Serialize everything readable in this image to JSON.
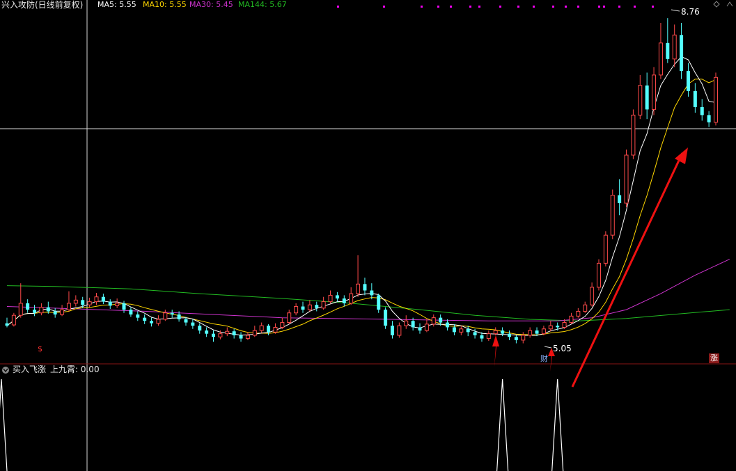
{
  "header": {
    "title": "兴入攻防",
    "subtitle": "(日线前复权)",
    "ma": [
      {
        "label": "MA5: 5.55",
        "color": "#ffffff"
      },
      {
        "label": "MA10: 5.55",
        "color": "#ffd700"
      },
      {
        "label": "MA30: 5.45",
        "color": "#cc33cc"
      },
      {
        "label": "MA144: 5.67",
        "color": "#22bb22"
      }
    ]
  },
  "indicator": {
    "title": "买入飞涨",
    "subtitle": "上九霄: 0.00",
    "toggle_icon": "chevron-down-icon"
  },
  "annotations": {
    "high_label": "8.76",
    "low_label": "5.05",
    "cai_marker": "财",
    "zhang_marker": "涨",
    "dollar_marker": "$"
  },
  "colors": {
    "up": "#ff4a4a",
    "down": "#54ffff",
    "ma5": "#ffffff",
    "ma10": "#ffd700",
    "ma30": "#cc33cc",
    "ma144": "#22bb22",
    "signal": "#ffffff",
    "arrow": "#ee1111",
    "dot": "#ee00ee",
    "divider": "#8a1515"
  },
  "chart_data": {
    "type": "candlestick",
    "candles": [
      [
        4.95,
        4.92,
        5.02,
        4.9
      ],
      [
        4.93,
        5.05,
        5.08,
        4.91
      ],
      [
        5.05,
        5.2,
        5.45,
        5.02
      ],
      [
        5.2,
        5.12,
        5.25,
        5.08
      ],
      [
        5.12,
        5.08,
        5.18,
        5.04
      ],
      [
        5.08,
        5.15,
        5.2,
        5.05
      ],
      [
        5.15,
        5.1,
        5.22,
        5.07
      ],
      [
        5.1,
        5.06,
        5.14,
        5.02
      ],
      [
        5.06,
        5.12,
        5.18,
        5.04
      ],
      [
        5.12,
        5.2,
        5.35,
        5.1
      ],
      [
        5.2,
        5.24,
        5.3,
        5.16
      ],
      [
        5.24,
        5.18,
        5.28,
        5.14
      ],
      [
        5.18,
        5.22,
        5.27,
        5.15
      ],
      [
        5.22,
        5.28,
        5.33,
        5.18
      ],
      [
        5.28,
        5.22,
        5.32,
        5.19
      ],
      [
        5.22,
        5.17,
        5.25,
        5.13
      ],
      [
        5.17,
        5.2,
        5.26,
        5.14
      ],
      [
        5.2,
        5.12,
        5.23,
        5.08
      ],
      [
        5.12,
        5.06,
        5.15,
        5.03
      ],
      [
        5.06,
        5.02,
        5.1,
        4.98
      ],
      [
        5.02,
        4.98,
        5.06,
        4.94
      ],
      [
        4.98,
        4.95,
        5.02,
        4.91
      ],
      [
        4.95,
        5.0,
        5.05,
        4.92
      ],
      [
        5.0,
        5.08,
        5.12,
        4.98
      ],
      [
        5.08,
        5.06,
        5.12,
        5.02
      ],
      [
        5.06,
        5.0,
        5.1,
        4.97
      ],
      [
        5.0,
        4.96,
        5.03,
        4.92
      ],
      [
        4.96,
        4.92,
        5.0,
        4.88
      ],
      [
        4.92,
        4.86,
        4.95,
        4.82
      ],
      [
        4.86,
        4.82,
        4.9,
        4.78
      ],
      [
        4.82,
        4.78,
        4.86,
        4.72
      ],
      [
        4.78,
        4.82,
        4.86,
        4.75
      ],
      [
        4.82,
        4.85,
        4.9,
        4.79
      ],
      [
        4.85,
        4.8,
        4.88,
        4.76
      ],
      [
        4.8,
        4.76,
        4.84,
        4.72
      ],
      [
        4.76,
        4.8,
        4.84,
        4.74
      ],
      [
        4.8,
        4.86,
        4.92,
        4.78
      ],
      [
        4.86,
        4.92,
        4.96,
        4.83
      ],
      [
        4.92,
        4.84,
        4.94,
        4.8
      ],
      [
        4.84,
        4.9,
        4.95,
        4.82
      ],
      [
        4.9,
        4.96,
        5.02,
        4.88
      ],
      [
        4.96,
        5.08,
        5.12,
        4.94
      ],
      [
        5.08,
        5.16,
        5.2,
        5.05
      ],
      [
        5.16,
        5.12,
        5.22,
        5.08
      ],
      [
        5.12,
        5.18,
        5.24,
        5.1
      ],
      [
        5.18,
        5.14,
        5.22,
        5.1
      ],
      [
        5.14,
        5.22,
        5.28,
        5.12
      ],
      [
        5.22,
        5.3,
        5.36,
        5.2
      ],
      [
        5.3,
        5.26,
        5.34,
        5.22
      ],
      [
        5.26,
        5.2,
        5.3,
        5.16
      ],
      [
        5.2,
        5.32,
        5.4,
        5.18
      ],
      [
        5.32,
        5.44,
        5.8,
        5.28
      ],
      [
        5.44,
        5.36,
        5.52,
        5.3
      ],
      [
        5.36,
        5.3,
        5.45,
        5.25
      ],
      [
        5.3,
        5.12,
        5.32,
        5.08
      ],
      [
        5.12,
        4.92,
        5.15,
        4.88
      ],
      [
        4.92,
        4.8,
        4.98,
        4.76
      ],
      [
        4.8,
        4.92,
        4.96,
        4.77
      ],
      [
        4.92,
        4.98,
        5.05,
        4.88
      ],
      [
        4.98,
        4.9,
        5.02,
        4.86
      ],
      [
        4.9,
        4.86,
        4.95,
        4.82
      ],
      [
        4.86,
        4.94,
        5.0,
        4.84
      ],
      [
        4.94,
        5.02,
        5.06,
        4.91
      ],
      [
        5.02,
        4.96,
        5.06,
        4.92
      ],
      [
        4.96,
        4.9,
        5.0,
        4.86
      ],
      [
        4.9,
        4.84,
        4.94,
        4.8
      ],
      [
        4.84,
        4.88,
        4.92,
        4.8
      ],
      [
        4.88,
        4.84,
        4.92,
        4.79
      ],
      [
        4.84,
        4.8,
        4.88,
        4.76
      ],
      [
        4.8,
        4.76,
        4.84,
        4.72
      ],
      [
        4.76,
        4.82,
        4.86,
        4.73
      ],
      [
        4.82,
        4.86,
        4.9,
        4.8
      ],
      [
        4.86,
        4.82,
        4.9,
        4.79
      ],
      [
        4.82,
        4.78,
        4.86,
        4.74
      ],
      [
        4.78,
        4.74,
        4.8,
        4.7
      ],
      [
        4.74,
        4.8,
        4.84,
        4.7
      ],
      [
        4.8,
        4.86,
        4.9,
        4.77
      ],
      [
        4.86,
        4.82,
        4.9,
        4.79
      ],
      [
        4.82,
        4.88,
        4.92,
        4.8
      ],
      [
        4.88,
        4.92,
        4.98,
        4.85
      ],
      [
        4.92,
        4.9,
        4.96,
        4.86
      ],
      [
        4.9,
        4.96,
        5.0,
        4.88
      ],
      [
        4.96,
        5.04,
        5.08,
        4.94
      ],
      [
        5.04,
        5.1,
        5.14,
        5.02
      ],
      [
        5.1,
        5.18,
        5.22,
        5.08
      ],
      [
        5.18,
        5.4,
        5.46,
        5.16
      ],
      [
        5.4,
        5.7,
        5.75,
        5.36
      ],
      [
        5.7,
        6.05,
        6.1,
        5.66
      ],
      [
        6.05,
        6.55,
        6.62,
        6.0
      ],
      [
        6.55,
        6.45,
        6.75,
        6.3
      ],
      [
        6.45,
        7.05,
        7.12,
        6.4
      ],
      [
        7.05,
        7.55,
        7.62,
        7.0
      ],
      [
        7.55,
        7.92,
        8.05,
        7.5
      ],
      [
        7.92,
        7.62,
        8.08,
        7.5
      ],
      [
        7.62,
        8.05,
        8.15,
        7.55
      ],
      [
        8.05,
        8.45,
        8.7,
        8.0
      ],
      [
        8.45,
        8.25,
        8.76,
        8.2
      ],
      [
        8.25,
        8.55,
        8.68,
        8.15
      ],
      [
        8.55,
        8.1,
        8.7,
        8.0
      ],
      [
        8.1,
        7.85,
        8.2,
        7.78
      ],
      [
        7.85,
        7.65,
        7.95,
        7.58
      ],
      [
        7.65,
        7.55,
        7.75,
        7.48
      ],
      [
        7.55,
        7.46,
        7.6,
        7.4
      ],
      [
        7.46,
        8.02,
        8.08,
        7.42
      ]
    ],
    "ma144": [
      [
        0,
        5.42
      ],
      [
        7,
        5.41
      ],
      [
        18,
        5.38
      ],
      [
        28,
        5.32
      ],
      [
        40,
        5.26
      ],
      [
        50,
        5.2
      ],
      [
        60,
        5.12
      ],
      [
        68,
        5.05
      ],
      [
        76,
        5.0
      ],
      [
        83,
        4.98
      ],
      [
        90,
        5.01
      ],
      [
        98,
        5.07
      ],
      [
        105,
        5.12
      ]
    ],
    "ma30_line": [
      [
        0,
        5.16
      ],
      [
        20,
        5.1
      ],
      [
        40,
        5.02
      ],
      [
        56,
        5.0
      ],
      [
        70,
        4.98
      ],
      [
        80,
        4.98
      ],
      [
        85,
        5.02
      ],
      [
        90,
        5.12
      ],
      [
        95,
        5.32
      ],
      [
        100,
        5.55
      ],
      [
        105,
        5.75
      ]
    ],
    "signals": [
      {
        "index": 0,
        "value": 1
      },
      {
        "index": 72,
        "value": 1
      },
      {
        "index": 80,
        "value": 1
      }
    ],
    "y_range": [
      4.6,
      8.9
    ]
  }
}
